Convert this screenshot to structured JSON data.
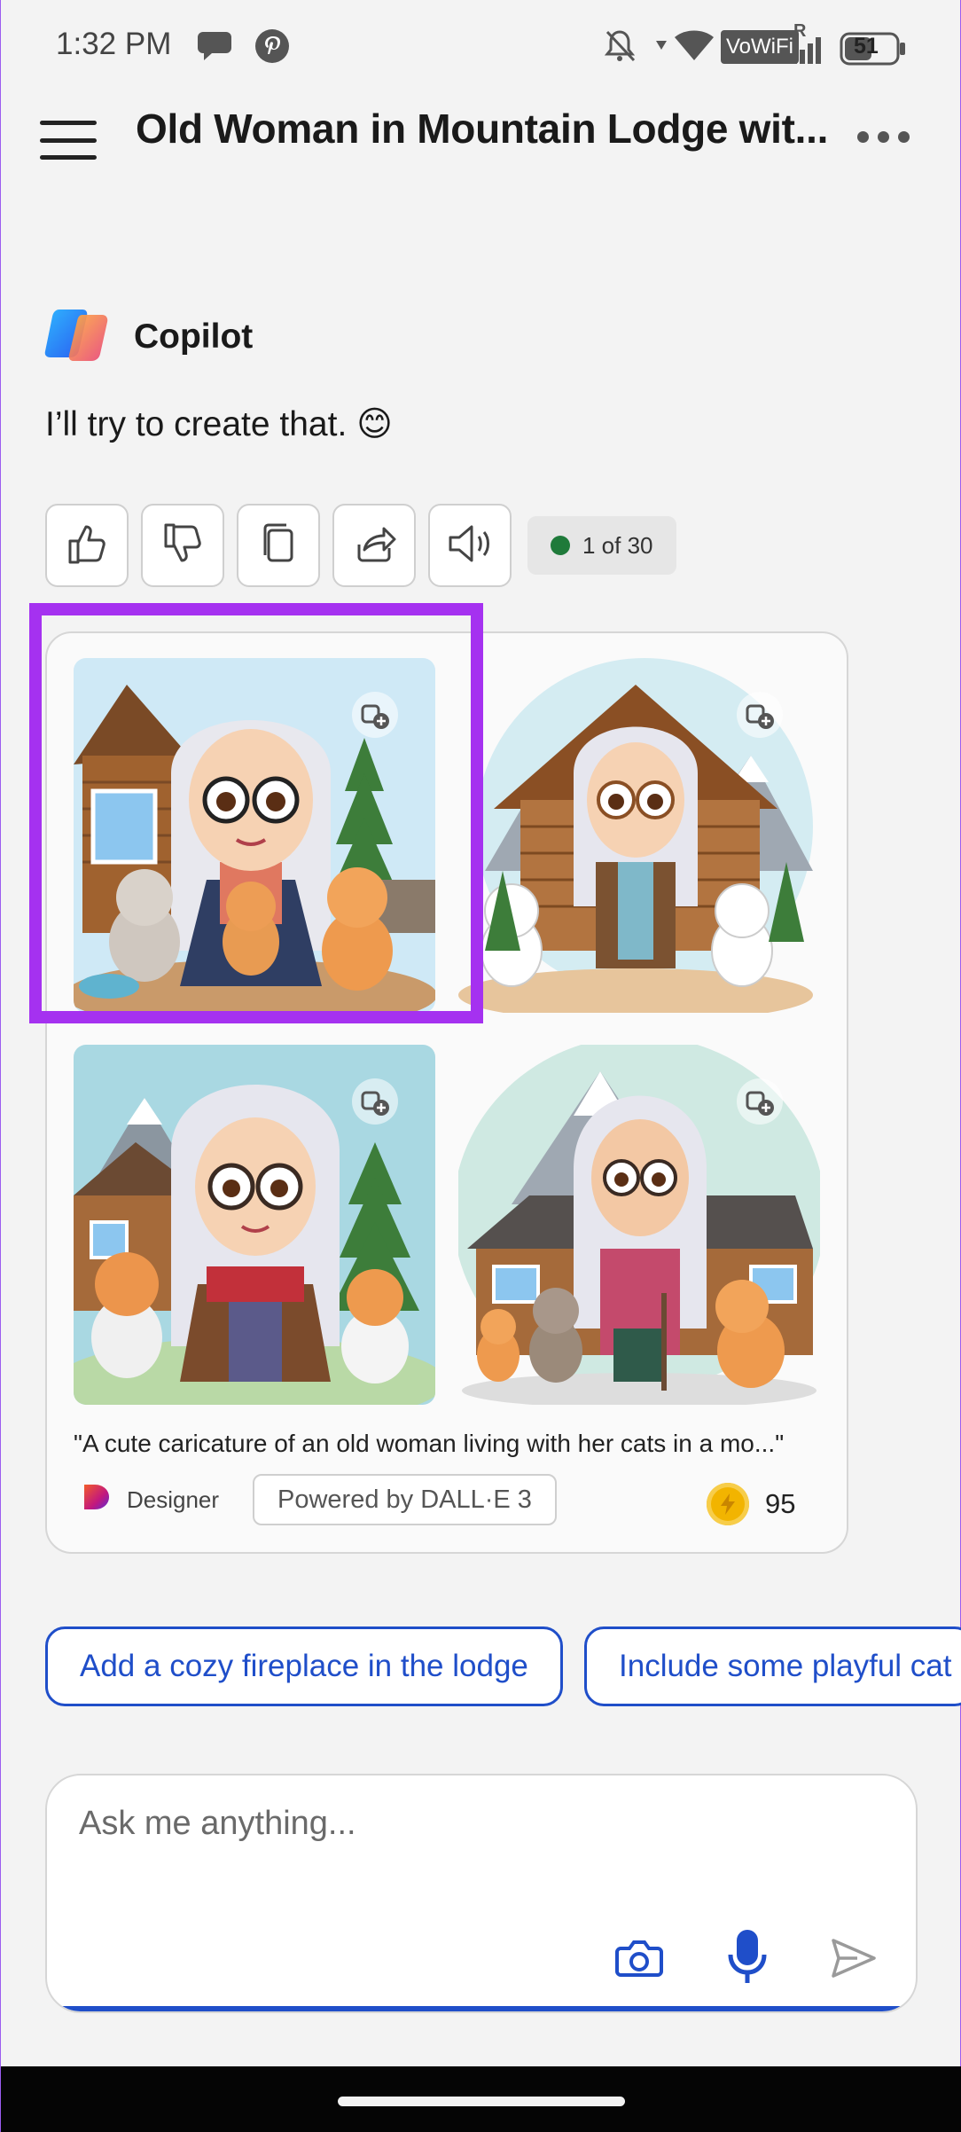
{
  "status_bar": {
    "time": "1:32 PM",
    "network_label": "VoWiFi",
    "signal_tag": "R",
    "battery": "51"
  },
  "app_bar": {
    "title": "Old Woman in Mountain Lodge wit..."
  },
  "message": {
    "sender": "Copilot",
    "text": "I’ll try to create that. 😊",
    "counter": "1 of 30"
  },
  "image_card": {
    "caption": "\"A cute caricature of an old woman living with her cats in a mo...\"",
    "designer_label": "Designer",
    "powered_by": "Powered by DALL·E 3",
    "boost_count": "95"
  },
  "suggestions": [
    "Add a cozy fireplace in the lodge",
    "Include some playful cat"
  ],
  "composer": {
    "placeholder": "Ask me anything..."
  },
  "colors": {
    "accent_blue": "#1f4ec9",
    "highlight_purple": "#a531f0",
    "status_green": "#1f7a3a"
  }
}
